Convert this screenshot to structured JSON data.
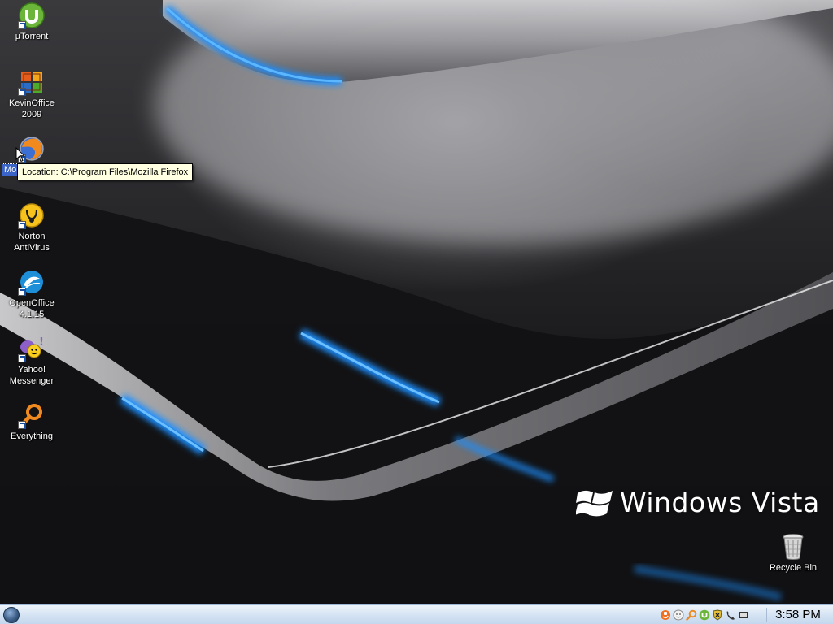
{
  "desktop": {
    "icons": [
      {
        "label": "µTorrent",
        "icon": "utorrent-icon"
      },
      {
        "label": "KevinOffice\n2009",
        "icon": "office-icon"
      },
      {
        "label": "Mo",
        "icon": "firefox-icon"
      },
      {
        "label": "Norton\nAntiVirus",
        "icon": "norton-icon"
      },
      {
        "label": "OpenOffice\n4.1.15",
        "icon": "openoffice-icon"
      },
      {
        "label": "Yahoo!\nMessenger",
        "icon": "yahoo-messenger-icon"
      },
      {
        "label": "Everything",
        "icon": "everything-search-icon"
      }
    ],
    "recycle_bin": {
      "label": "Recycle Bin",
      "icon": "recycle-bin-icon"
    },
    "tooltip": "Location: C:\\Program Files\\Mozilla Firefox",
    "branding": "Windows Vista"
  },
  "taskbar": {
    "start_icon": "start-orb-icon",
    "tray_icons": [
      "java-icon",
      "messenger-tray-icon",
      "search-tray-icon",
      "utorrent-tray-icon",
      "security-tray-icon",
      "phone-tray-icon",
      "display-tray-icon"
    ],
    "clock": "3:58 PM"
  },
  "colors": {
    "accent_blue": "#1e8fff",
    "taskbar_top": "#eef4fb",
    "taskbar_bottom": "#c4d7ee",
    "tooltip_bg": "#ffffe1"
  }
}
